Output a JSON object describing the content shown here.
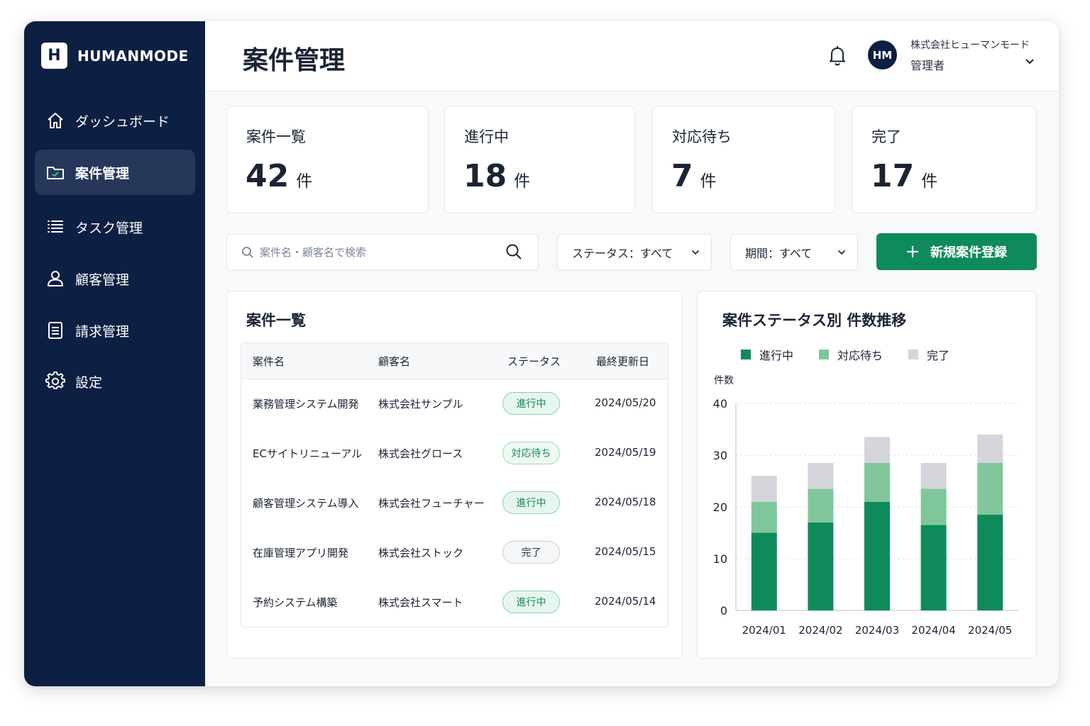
{
  "sidebar": {
    "brand": {
      "logo_letter": "H",
      "name": "HUMANMODE"
    },
    "items": [
      {
        "label": "ダッシュボード",
        "icon": "home-icon",
        "active": false
      },
      {
        "label": "案件管理",
        "icon": "folder-icon",
        "active": true
      },
      {
        "label": "タスク管理",
        "icon": "list-icon",
        "active": false
      },
      {
        "label": "顧客管理",
        "icon": "user-icon",
        "active": false
      },
      {
        "label": "請求管理",
        "icon": "document-icon",
        "active": false
      },
      {
        "label": "設定",
        "icon": "gear-icon",
        "active": false
      }
    ]
  },
  "header": {
    "title": "案件管理",
    "user": {
      "initials": "HM",
      "company": "株式会社ヒューマンモード",
      "role": "管理者"
    }
  },
  "stats": [
    {
      "label": "案件一覧",
      "value": "42",
      "unit": "件"
    },
    {
      "label": "進行中",
      "value": "18",
      "unit": "件"
    },
    {
      "label": "対応待ち",
      "value": "7",
      "unit": "件"
    },
    {
      "label": "完了",
      "value": "17",
      "unit": "件"
    }
  ],
  "filters": {
    "search_placeholder": "案件名・顧客名で検索",
    "status": "ステータス：すべて",
    "period": "期間：すべて",
    "new_button": "新規案件登録"
  },
  "table": {
    "title": "案件一覧",
    "columns": [
      "案件名",
      "顧客名",
      "ステータス",
      "最終更新日"
    ],
    "rows": [
      {
        "name": "業務管理システム開発",
        "client": "株式会社サンプル",
        "status": "進行中",
        "updated": "2024/05/20"
      },
      {
        "name": "ECサイトリニューアル",
        "client": "株式会社グロース",
        "status": "対応待ち",
        "updated": "2024/05/19"
      },
      {
        "name": "顧客管理システム導入",
        "client": "株式会社フューチャー",
        "status": "進行中",
        "updated": "2024/05/18"
      },
      {
        "name": "在庫管理アプリ開発",
        "client": "株式会社ストック",
        "status": "完了",
        "updated": "2024/05/15"
      },
      {
        "name": "予約システム構築",
        "client": "株式会社スマート",
        "status": "進行中",
        "updated": "2024/05/14"
      }
    ]
  },
  "colors": {
    "sidebar": "#0d1f42",
    "accent": "#0f8a5b",
    "in_progress": "#0f8a5b",
    "waiting": "#7fc79b",
    "done": "#d3d5da"
  },
  "chart_data": {
    "type": "bar",
    "stacked": true,
    "title": "案件ステータス別 件数推移",
    "ylabel": "件数",
    "xlabel": "",
    "categories": [
      "2024/01",
      "2024/02",
      "2024/03",
      "2024/04",
      "2024/05"
    ],
    "series": [
      {
        "name": "進行中",
        "color": "#0f8a5b",
        "values": [
          15,
          17,
          21,
          16.5,
          18.5
        ]
      },
      {
        "name": "対応待ち",
        "color": "#7fc79b",
        "values": [
          6,
          6.5,
          7.5,
          7,
          10
        ]
      },
      {
        "name": "完了",
        "color": "#d3d5da",
        "values": [
          5,
          5,
          5,
          5,
          5.5
        ]
      }
    ],
    "ylim": [
      0,
      40
    ],
    "yticks": [
      0,
      10,
      20,
      30,
      40
    ],
    "grid": true,
    "legend_position": "top-left"
  }
}
